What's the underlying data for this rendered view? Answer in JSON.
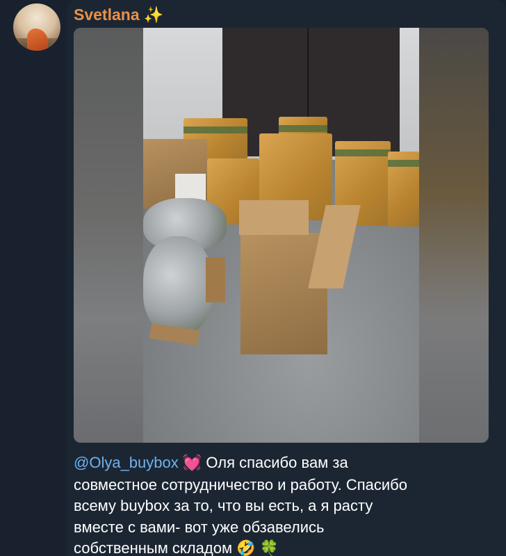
{
  "message": {
    "author": "Svetlana",
    "author_emoji": "✨",
    "mention": "@Olya_buybox",
    "mention_emoji": "💓",
    "text_line1": " Оля спасибо вам за",
    "text_line2": "совместное сотрудничество и работу. Спасибо",
    "text_line3": "всему buybox за то, что вы есть, а я расту",
    "text_line4": "вместе с вами- вот уже обзавелись",
    "text_line5": "собственным складом ",
    "end_emoji_1": "🤣",
    "end_emoji_2": "🍀"
  },
  "colors": {
    "author": "#e8914a",
    "mention": "#6fb2ef",
    "background": "#18212d"
  },
  "icons": {
    "avatar": "avatar-photo",
    "sparkles": "sparkles-emoji",
    "heart": "beating-heart-emoji",
    "laugh": "rolling-on-floor-laughing-emoji",
    "clover": "four-leaf-clover-emoji"
  }
}
